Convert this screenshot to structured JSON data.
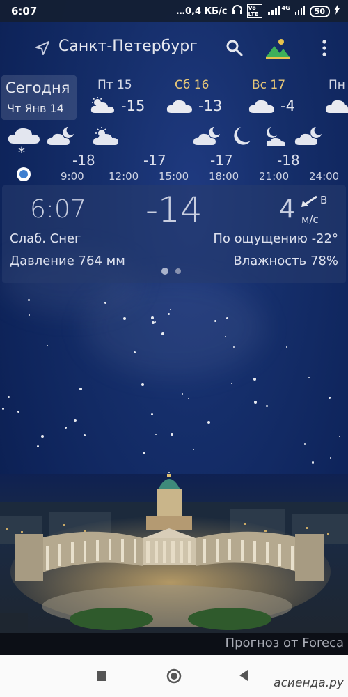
{
  "status_bar": {
    "time": "6:07",
    "network": "…0,4 КБ/с",
    "volte": "Vo LTE",
    "signal_label": "4G",
    "battery": "50"
  },
  "header": {
    "city": "Санкт-Петербург",
    "search_icon": "search-icon",
    "background_icon": "landscape-icon",
    "menu_icon": "more-vert-icon",
    "location_icon": "location-arrow-icon"
  },
  "days": {
    "today": {
      "label": "Сегодня",
      "date": "Чт Янв 14"
    },
    "items": [
      {
        "name": "Пт 15",
        "temp": "-15",
        "icon": "partly-cloudy-day-icon"
      },
      {
        "name": "Сб 16",
        "temp": "-13",
        "icon": "cloud-icon"
      },
      {
        "name": "Вс 17",
        "temp": "-4",
        "icon": "cloud-icon"
      },
      {
        "name": "Пн",
        "temp": "",
        "icon": "cloud-icon"
      }
    ]
  },
  "hourly": {
    "now_icon": "cloud-snow-icon",
    "items": [
      {
        "time": "9:00",
        "temp": "-18",
        "icon": "cloud-moon-icon"
      },
      {
        "time": "12:00",
        "temp": "",
        "icon": "partly-cloudy-day-icon"
      },
      {
        "time": "15:00",
        "temp": "-17",
        "icon": ""
      },
      {
        "time": "18:00",
        "temp": "-17",
        "icon": "cloud-moon-icon"
      },
      {
        "time": "21:00",
        "temp": "-18",
        "icon": "moon-icon"
      },
      {
        "time": "24:00",
        "temp": "",
        "icon": "cloud-moon-icon"
      }
    ],
    "extra_icon": "cloud-moon-icon"
  },
  "current": {
    "time": "6:07",
    "temp": "-14",
    "wind_speed": "4",
    "wind_dir": "В",
    "wind_unit": "м/с",
    "condition": "Слаб. Снег",
    "feels_like": "По ощущению -22°",
    "pressure": "Давление 764 мм",
    "humidity": "Влажность 78%"
  },
  "footer": {
    "credit": "Прогноз от Foreca"
  },
  "watermark": "асиенда.ру"
}
